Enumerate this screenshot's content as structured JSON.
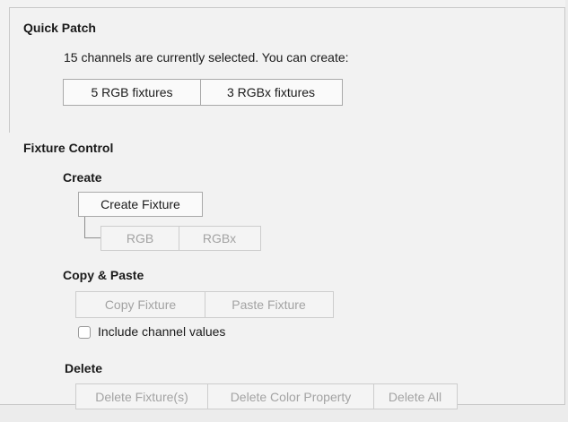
{
  "quick_patch": {
    "heading": "Quick Patch",
    "summary": "15 channels are currently selected. You can create:",
    "options": [
      "5 RGB fixtures",
      "3 RGBx fixtures"
    ]
  },
  "fixture_control": {
    "heading": "Fixture Control",
    "create": {
      "heading": "Create",
      "create_button": "Create Fixture",
      "types": [
        "RGB",
        "RGBx"
      ]
    },
    "copy_paste": {
      "heading": "Copy & Paste",
      "copy_button": "Copy Fixture",
      "paste_button": "Paste Fixture",
      "include_values_label": "Include channel values",
      "include_values_checked": false
    },
    "delete": {
      "heading": "Delete",
      "delete_fixtures": "Delete Fixture(s)",
      "delete_color_property": "Delete Color Property",
      "delete_all": "Delete All"
    }
  }
}
